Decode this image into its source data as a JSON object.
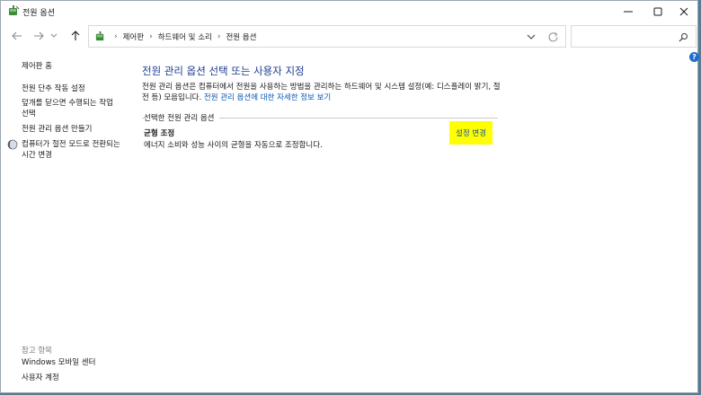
{
  "window": {
    "title": "전원 옵션"
  },
  "address": {
    "crumbs": [
      "제어판",
      "하드웨어 및 소리",
      "전원 옵션"
    ],
    "separator": "›"
  },
  "search": {
    "placeholder": ""
  },
  "sidebar": {
    "items": [
      {
        "label": "제어판 홈"
      },
      {
        "label": "전원 단추 작동 설정"
      },
      {
        "label": "덮개를 닫으면 수행되는 작업 선택"
      },
      {
        "label": "전원 관리 옵션 만들기"
      },
      {
        "label": "컴퓨터가 절전 모드로 전환되는 시간 변경",
        "icon": "moon-icon"
      }
    ],
    "see_also": {
      "heading": "참고 항목",
      "items": [
        {
          "label": "Windows 모바일 센터"
        },
        {
          "label": "사용자 계정"
        }
      ]
    }
  },
  "main": {
    "title": "전원 관리 옵션 선택 또는 사용자 지정",
    "description": "전원 관리 옵션은 컴퓨터에서 전원을 사용하는 방법을 관리하는 하드웨어 및 시스템 설정(예: 디스플레이 밝기, 절전 등) 모음입니다.",
    "description_link": "전원 관리 옵션에 대한 자세한 정보 보기",
    "section_label": "선택한 전원 관리 옵션",
    "plan": {
      "name": "균형 조정",
      "description": "에너지 소비와 성능 사이의 균형을 자동으로 조정합니다.",
      "change_label": "설정 변경"
    }
  },
  "help": {
    "label": "?"
  },
  "colors": {
    "title_blue": "#1c3a8f",
    "link_blue": "#0a55b3",
    "highlight": "#ffff00",
    "desktop": "#5a7a93"
  }
}
